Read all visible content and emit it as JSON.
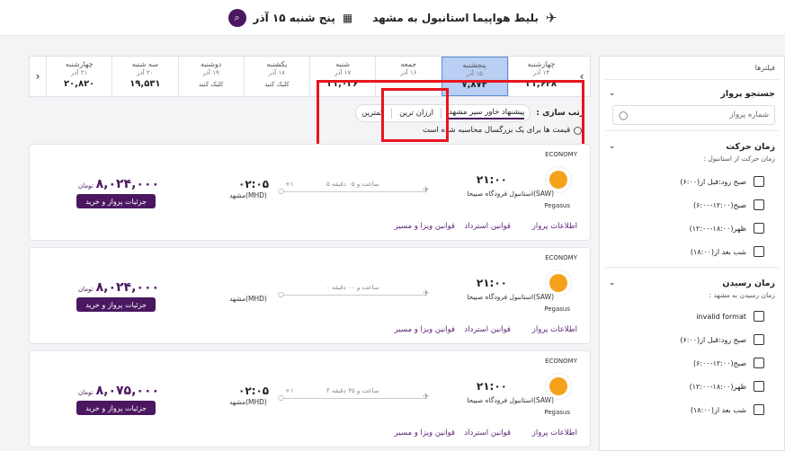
{
  "header": {
    "route_title": "بلیط هواپیما استانبول به مشهد",
    "date": "پنج شنبه ۱۵ آذر",
    "calendar_icon": "calendar-icon",
    "plane_icon": "plane-icon",
    "search_icon": "search-icon"
  },
  "datebar": {
    "days": [
      {
        "day": "چهارشنبه",
        "date": "۱۴ آذر",
        "price": "۲۱,۶۴۸",
        "selected": false,
        "cta": ""
      },
      {
        "day": "پنجشنبه",
        "date": "۱۵ آذر",
        "price": "۷,۸۷۴",
        "selected": true,
        "cta": ""
      },
      {
        "day": "جمعه",
        "date": "۱۶ آذر",
        "price": "",
        "selected": false,
        "cta": ""
      },
      {
        "day": "شنبه",
        "date": "۱۷ آذر",
        "price": "۲۱,۰۲۶",
        "selected": false,
        "cta": ""
      },
      {
        "day": "یکشنبه",
        "date": "۱۸ آذر",
        "price": "",
        "selected": false,
        "cta": "کلیک کنید"
      },
      {
        "day": "دوشنبه",
        "date": "۱۹ آذر",
        "price": "",
        "selected": false,
        "cta": "کلیک کنید"
      },
      {
        "day": "سه شنبه",
        "date": "۲۰ آذر",
        "price": "۱۹,۵۳۱",
        "selected": false,
        "cta": ""
      },
      {
        "day": "چهارشنبه",
        "date": "۲۱ آذر",
        "price": "۲۰,۸۲۰",
        "selected": false,
        "cta": ""
      }
    ]
  },
  "sort": {
    "label": "رتب سازی :",
    "options": [
      "پیشنهاد خاور سیر مشهد",
      "ارزان ترین",
      "کمترین"
    ],
    "active": 0
  },
  "notice": "قیمت ها برای یک بزرگسال محاسبه شده است",
  "flights": [
    {
      "cabin": "ECONOMY",
      "airline": "Pegasus",
      "dep_time": "۲۱:۰۰",
      "dep_airport": "استانبول فرودگاه صبیحا(SAW)",
      "duration": "۵ ساعت و ۰۵ دقیقه",
      "day_plus": "+۱",
      "arr_time": "۰۲:۰۵",
      "arr_airport": "مشهد(MHD)",
      "price": "۸,۰۲۴,۰۰۰",
      "currency": "تومان",
      "buy": "جزئیات پرواز و خرید",
      "links": [
        "اطلاعات پرواز",
        "قوانین استرداد",
        "قوانین ویزا و مسیر"
      ]
    },
    {
      "cabin": "ECONOMY",
      "airline": "Pegasus",
      "dep_time": "۲۱:۰۰",
      "dep_airport": "استانبول فرودگاه صبیحا(SAW)",
      "duration": "۰ ساعت و ۰۰ دقیقه",
      "day_plus": "",
      "arr_time": "",
      "arr_airport": "مشهد(MHD)",
      "price": "۸,۰۲۴,۰۰۰",
      "currency": "تومان",
      "buy": "جزئیات پرواز و خرید",
      "links": [
        "اطلاعات پرواز",
        "قوانین استرداد",
        "قوانین ویزا و مسیر"
      ]
    },
    {
      "cabin": "ECONOMY",
      "airline": "Pegasus",
      "dep_time": "۲۱:۰۰",
      "dep_airport": "استانبول فرودگاه صبیحا(SAW)",
      "duration": "۴ ساعت و ۳۵ دقیقه",
      "day_plus": "+۱",
      "arr_time": "۰۲:۰۵",
      "arr_airport": "مشهد(MHD)",
      "price": "۸,۰۷۵,۰۰۰",
      "currency": "تومان",
      "buy": "جزئیات پرواز و خرید",
      "links": [
        "اطلاعات پرواز",
        "قوانین استرداد",
        "قوانین ویزا و مسیر"
      ]
    }
  ],
  "sidebar": {
    "title": "فیلترها",
    "search_flight": {
      "title": "جستجو پرواز",
      "placeholder": "شماره پرواز"
    },
    "departure": {
      "title": "زمان حرکت",
      "subtitle": "زمان حرکت از استانبول :",
      "options": [
        "صبح زود:قبل از(۶:۰۰)",
        "صبح(۱۲:۰۰-۶:۰۰)",
        "ظهر(۱۸:۰۰-۱۲:۰۰)",
        "شب بعد از(۱۸:۰۰)"
      ]
    },
    "arrival": {
      "title": "زمان رسیدن",
      "subtitle": "زمان رسیدن به مشهد :",
      "options": [
        "invalid format",
        "صبح زود:قبل از(۶:۰۰)",
        "صبح(۱۲:۰۰-۶:۰۰)",
        "ظهر(۱۸:۰۰-۱۲:۰۰)",
        "شب بعد از(۱۸:۰۰)"
      ]
    }
  }
}
